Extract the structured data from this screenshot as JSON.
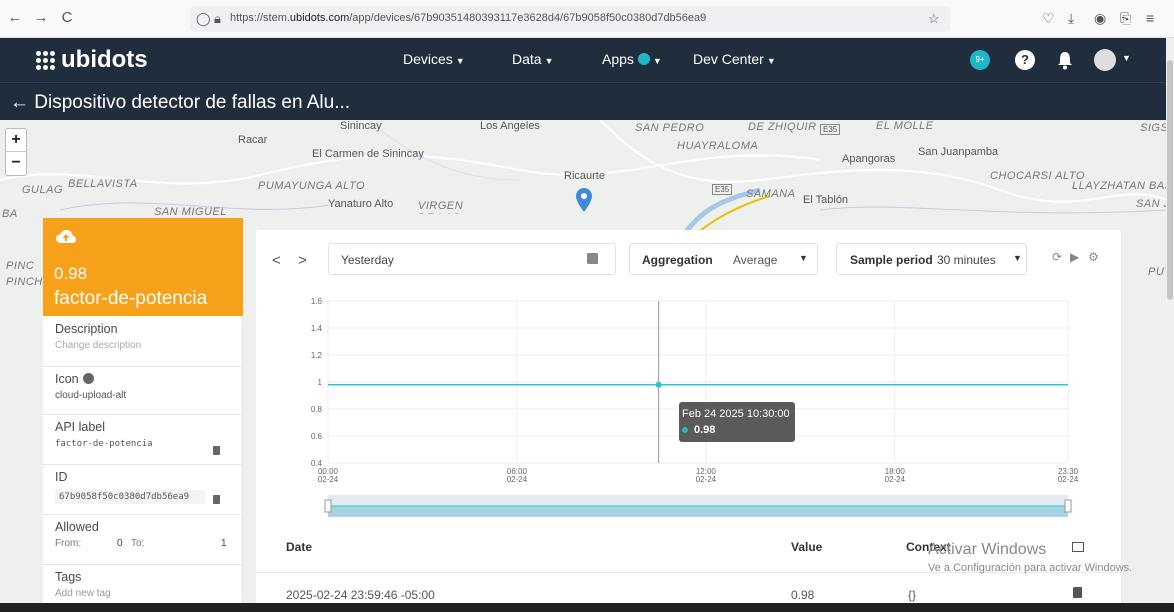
{
  "browser": {
    "back": "←",
    "forward": "→",
    "reload": "C",
    "url_prefix": "https://stem.",
    "url_domain": "ubidots.com",
    "url_suffix": "/app/devices/67b90351480393117e3628d4/67b9058f50c0380d7db56ea9"
  },
  "header": {
    "logo": "ubidots",
    "menu": [
      {
        "label": "Devices"
      },
      {
        "label": "Data"
      },
      {
        "label": "Apps"
      },
      {
        "label": "Dev Center"
      }
    ],
    "badge": "9+",
    "help": "?"
  },
  "device": {
    "title": "← Dispositivo detector de fallas en Alu..."
  },
  "map": {
    "labels": [
      "Sinincay",
      "Racar",
      "El Carmen de Sinincay",
      "Los Angeles",
      "SAN PEDRO",
      "DE ZHIQUIR",
      "E35",
      "EL MOLLE",
      "SIGSI",
      "HUAYRALOMA",
      "Apangoras",
      "San Juanpamba",
      "CHOCARSI ALTO",
      "GULAG",
      "BELLAVISTA",
      "PUMAYUNGA ALTO",
      "Ricaurte",
      "E35",
      "SAMANA",
      "El Tablón",
      "LLAYZHATAN BAJ",
      "SAN J",
      "BA",
      "SAN MIGUEL",
      "Yanaturo Alto",
      "VIRGEN DE LAS NIEVES",
      "PINC",
      "PINCH",
      "PUT"
    ],
    "zoom_in": "+",
    "zoom_out": "−"
  },
  "variable": {
    "value": "0.98",
    "name": "factor-de-potencia",
    "icon": "cloud-upload-icon",
    "description_label": "Description",
    "description_placeholder": "Change description",
    "icon_label": "Icon",
    "icon_value": "cloud-upload-alt",
    "api_label_title": "API label",
    "api_label_value": "factor-de-potencia",
    "id_label": "ID",
    "id_value": "67b9058f50c0380d7db56ea9",
    "allowed_label": "Allowed",
    "from_label": "From:",
    "from_value": "0",
    "to_label": "To:",
    "to_value": "1",
    "tags_label": "Tags",
    "tags_placeholder": "Add new tag"
  },
  "controls": {
    "prev": "<",
    "next": ">",
    "date_range": "Yesterday",
    "aggregation_label": "Aggregation",
    "aggregation_value": "Average",
    "sample_label": "Sample period",
    "sample_value": "30 minutes"
  },
  "chart_data": {
    "type": "line",
    "x_ticks": [
      {
        "time": "00:00",
        "date": "02-24"
      },
      {
        "time": "06:00",
        "date": "02-24"
      },
      {
        "time": "12:00",
        "date": "02-24"
      },
      {
        "time": "18:00",
        "date": "02-24"
      },
      {
        "time": "23:30",
        "date": "02-24"
      }
    ],
    "y_ticks": [
      "1.6",
      "1.4",
      "1.2",
      "1",
      "0.8",
      "0.6",
      "0.4"
    ],
    "ylim": [
      0.4,
      1.6
    ],
    "xlim_hours": [
      0,
      23.5
    ],
    "series": [
      {
        "color": "#2ec4d6",
        "x_hours": [
          0,
          23.5
        ],
        "values": [
          0.98,
          0.98
        ]
      }
    ],
    "hover_x_hours": 10.5,
    "tooltip": {
      "date": "Feb 24 2025 10:30:00",
      "value": "0.98"
    }
  },
  "table": {
    "headers": {
      "date": "Date",
      "value": "Value",
      "context": "Context"
    },
    "rows": [
      {
        "date": "2025-02-24 23:59:46 -05:00",
        "value": "0.98",
        "context": "{}"
      }
    ]
  },
  "watermark": {
    "line1": "Activar Windows",
    "line2": "Ve a Configuración para activar Windows."
  },
  "colors": {
    "accent": "#f7a11a",
    "header": "#1f2d3d",
    "series": "#2ec4d6"
  }
}
